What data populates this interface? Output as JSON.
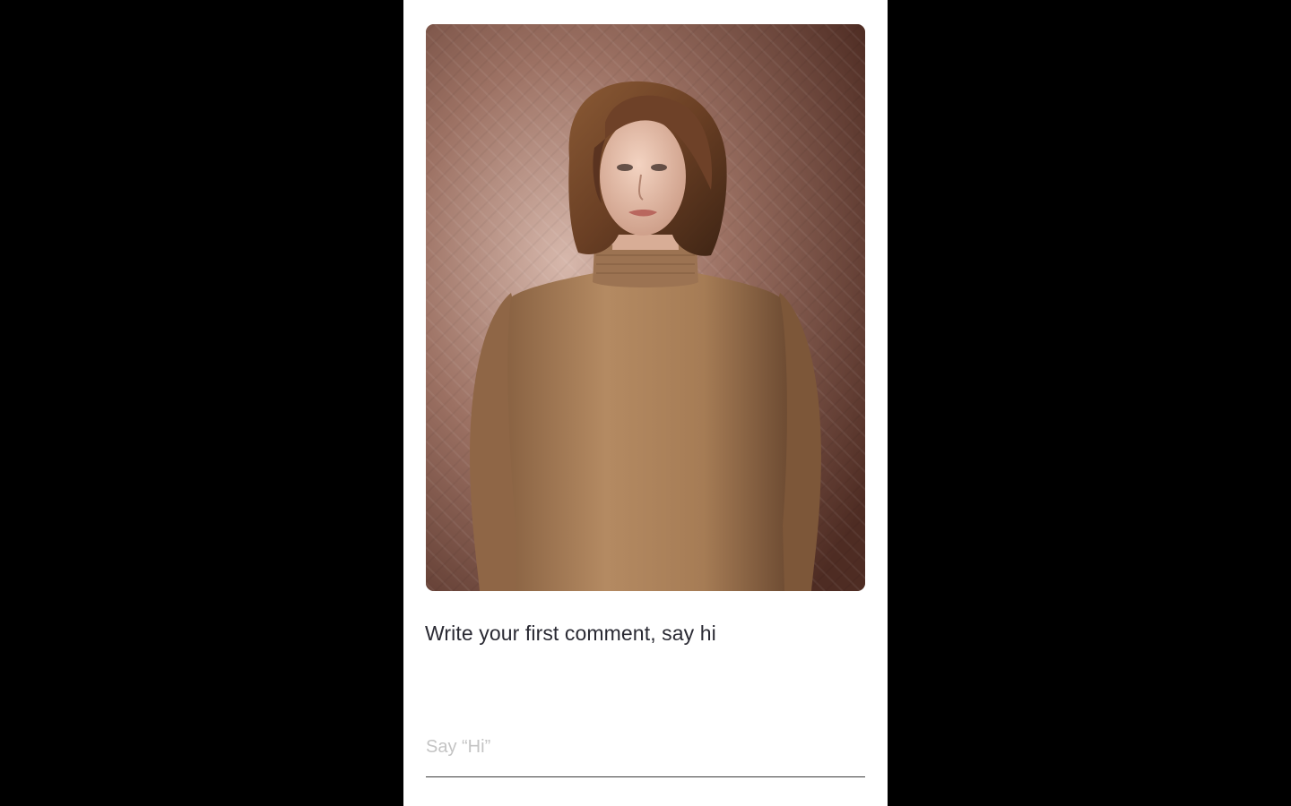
{
  "feed_card": {
    "photo": {
      "icon": "portrait-photo",
      "colors": {
        "background": "#7a5448",
        "sweater": "#a57a55",
        "hair": "#6a3f24",
        "skin": "#e9c3ae"
      }
    },
    "prompt": "Write your first comment, say hi",
    "comment_input": {
      "value": "",
      "placeholder": "Say “Hi”"
    }
  },
  "colors": {
    "page_background": "#000000",
    "panel_background": "#ffffff",
    "text": "#2a2a33",
    "placeholder": "#c4c4c4",
    "underline": "#3a3a3a"
  }
}
